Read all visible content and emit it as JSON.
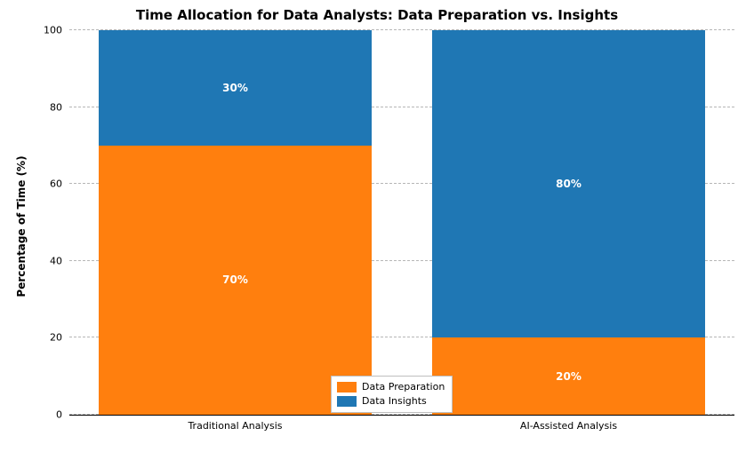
{
  "chart_data": {
    "type": "bar",
    "stacked": true,
    "title": "Time Allocation for Data Analysts: Data Preparation vs. Insights",
    "ylabel": "Percentage of Time (%)",
    "xlabel": "",
    "ylim": [
      0,
      100
    ],
    "yticks": [
      0,
      20,
      40,
      60,
      80,
      100
    ],
    "categories": [
      "Traditional Analysis",
      "AI-Assisted Analysis"
    ],
    "series": [
      {
        "name": "Data Preparation",
        "color": "#ff7f0e",
        "values": [
          70,
          20
        ]
      },
      {
        "name": "Data Insights",
        "color": "#1f77b4",
        "values": [
          30,
          80
        ]
      }
    ],
    "labels": {
      "bar0_prep": "70%",
      "bar0_insight": "30%",
      "bar1_prep": "20%",
      "bar1_insight": "80%",
      "ytick_0": "0",
      "ytick_20": "20",
      "ytick_40": "40",
      "ytick_60": "60",
      "ytick_80": "80",
      "ytick_100": "100"
    },
    "legend_position": "lower center"
  }
}
